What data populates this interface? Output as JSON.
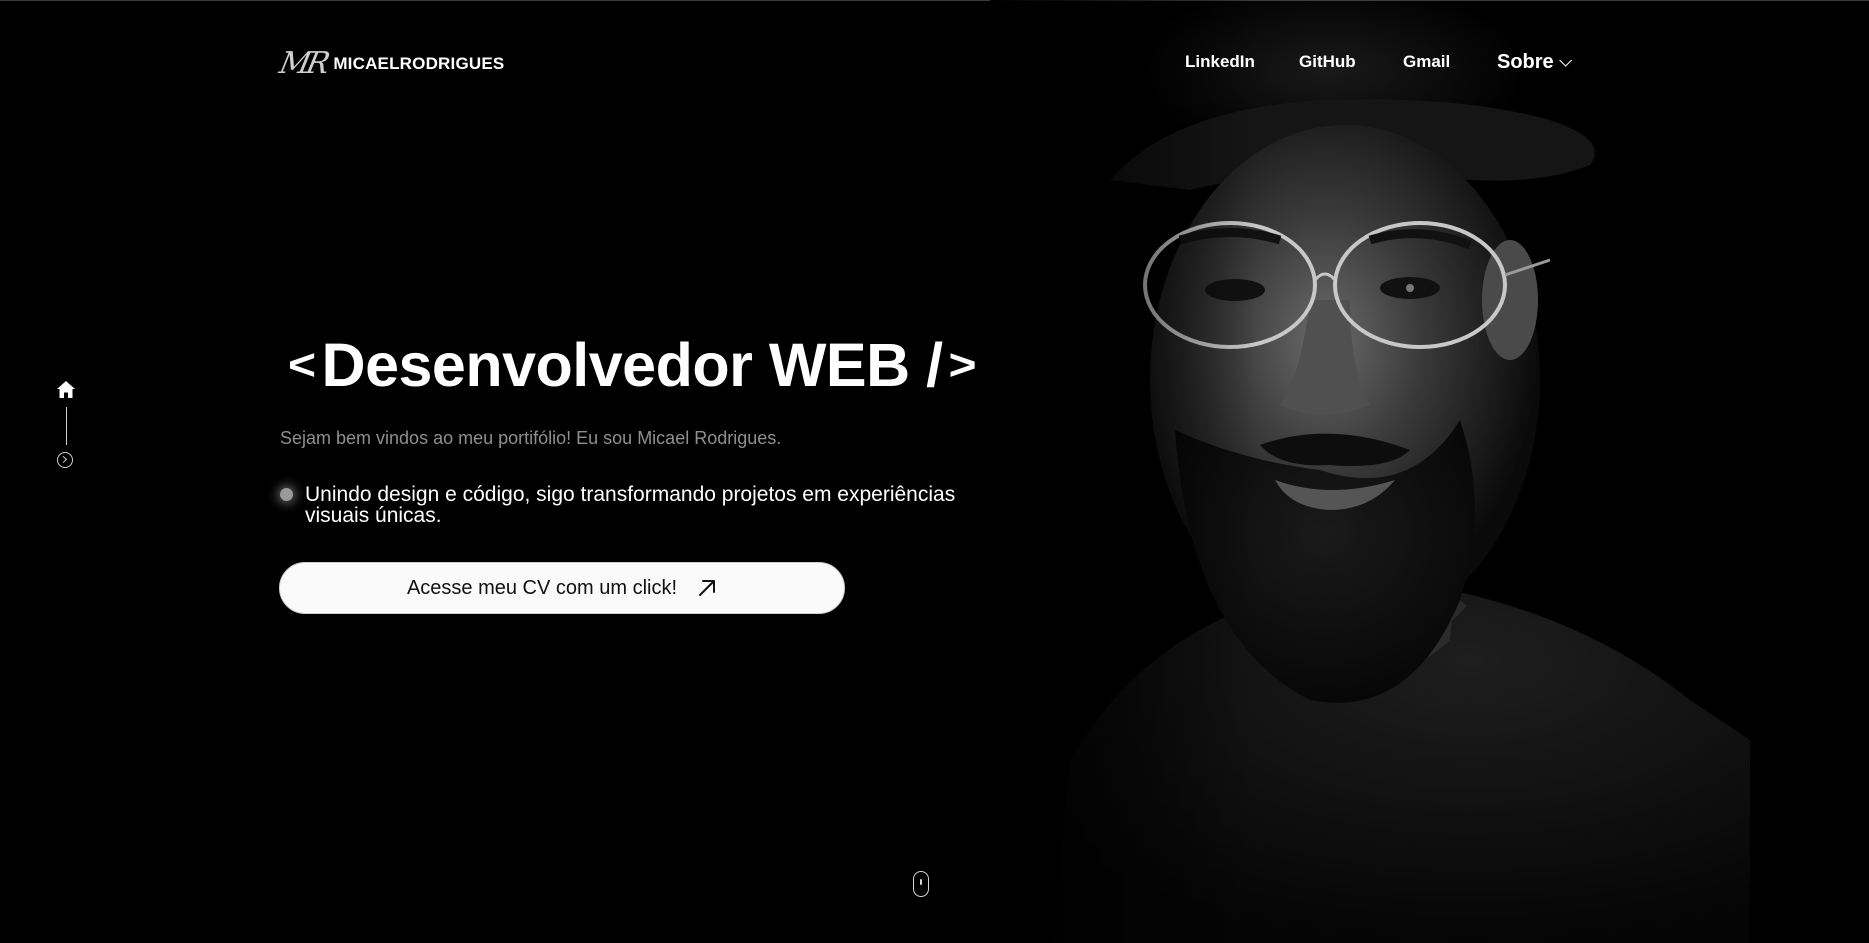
{
  "header": {
    "logo_mark": "MR",
    "logo_text": "MICAELRODRIGUES",
    "nav": [
      {
        "label": "LinkedIn"
      },
      {
        "label": "GitHub"
      },
      {
        "label": "Gmail"
      },
      {
        "label": "Sobre"
      }
    ]
  },
  "side_nav": {
    "icons": [
      "home-icon",
      "chevron-right-circle-icon"
    ]
  },
  "hero": {
    "bracket_open": "<",
    "title": "Desenvolvedor WEB /",
    "bracket_close": ">",
    "subtitle": "Sejam bem vindos ao meu portifólio! Eu sou Micael Rodrigues.",
    "tagline": "Unindo design e código, sigo transformando projetos em experiências visuais únicas.",
    "cta_label": "Acesse meu CV com um click!"
  },
  "colors": {
    "background": "#000000",
    "text": "#ffffff",
    "muted_text": "#8f8f8f",
    "button_bg": "#fafafa",
    "button_text": "#111111"
  }
}
